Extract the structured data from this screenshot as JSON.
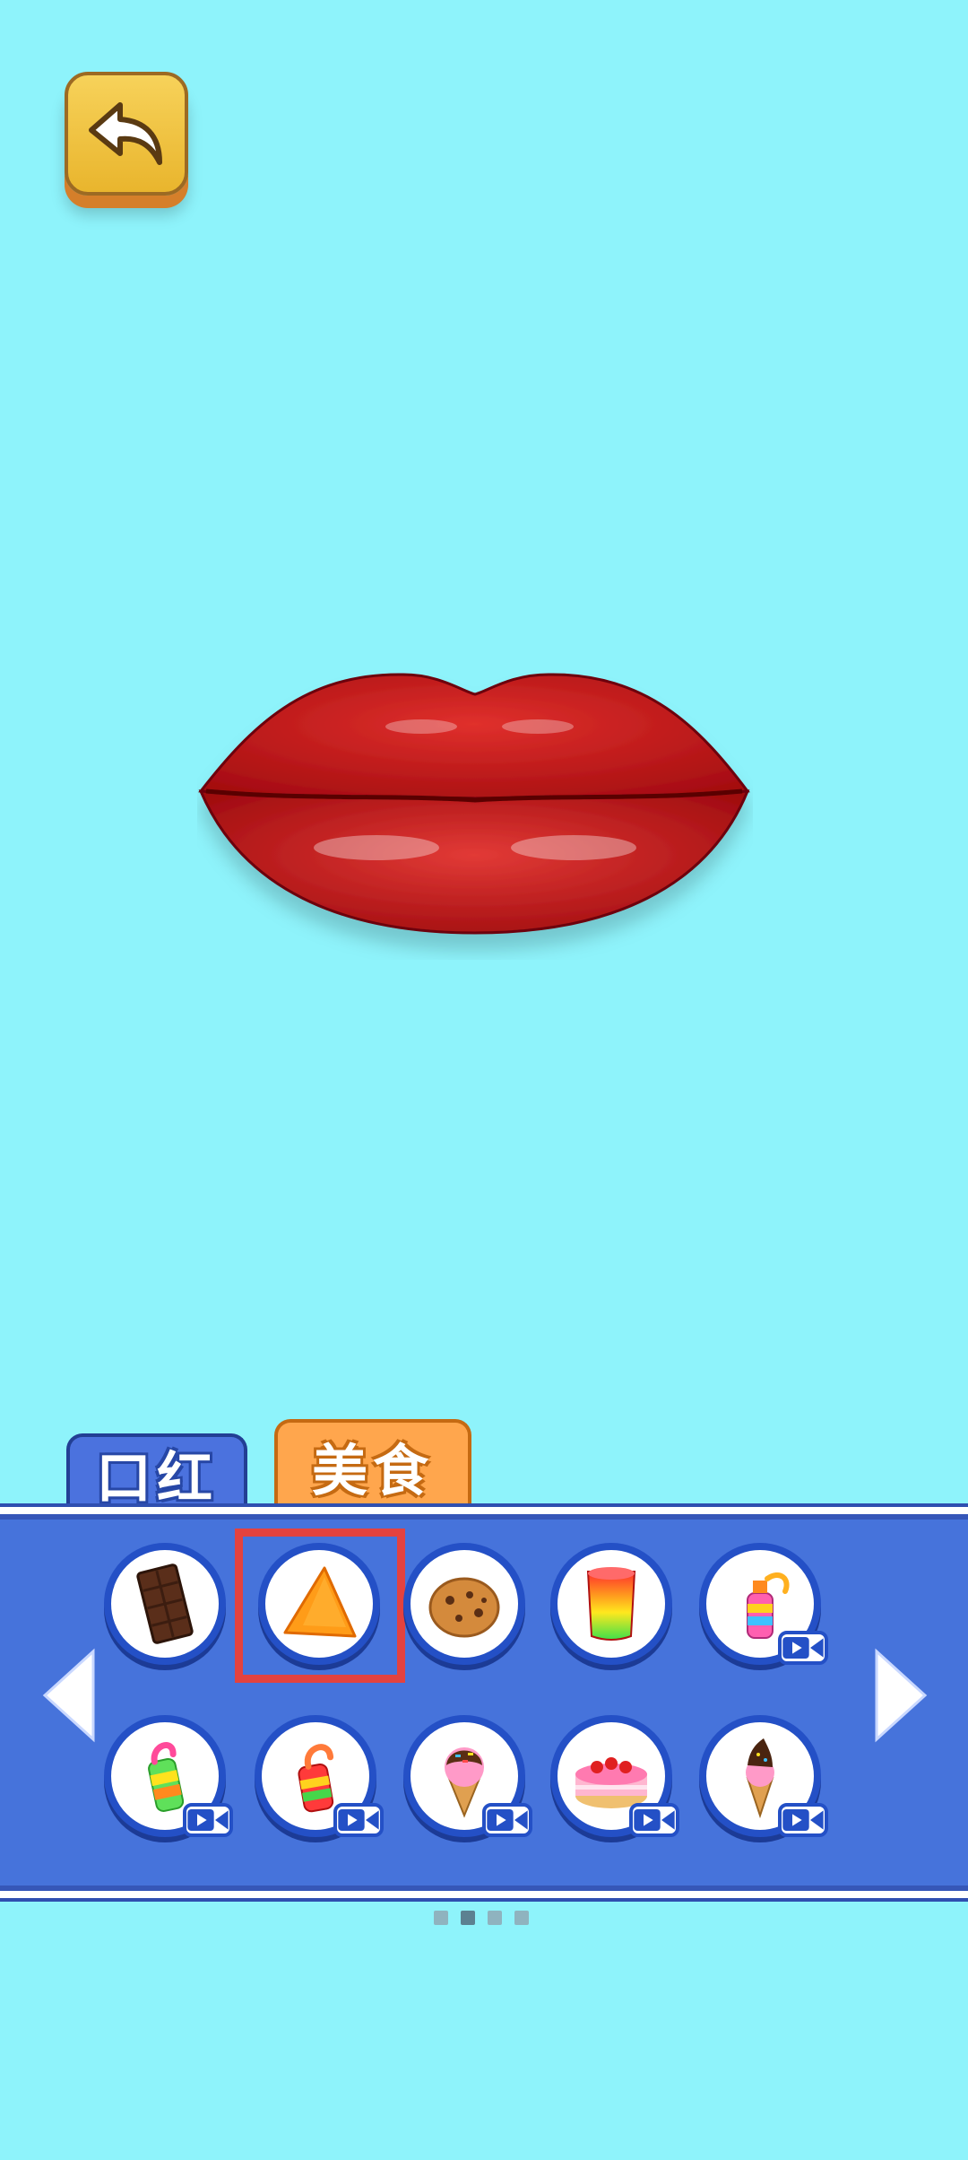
{
  "tabs": [
    {
      "label": "口红",
      "active": false
    },
    {
      "label": "美食",
      "active": true
    }
  ],
  "items": [
    {
      "icon": "chocolate-bar-icon",
      "locked_video": false,
      "selected": false
    },
    {
      "icon": "nacho-chip-icon",
      "locked_video": false,
      "selected": true
    },
    {
      "icon": "cookie-icon",
      "locked_video": false,
      "selected": false
    },
    {
      "icon": "rainbow-jelly-cup-icon",
      "locked_video": false,
      "selected": false
    },
    {
      "icon": "candy-spray-bottle-icon",
      "locked_video": true,
      "selected": false
    },
    {
      "icon": "gummy-bottle-icon",
      "locked_video": true,
      "selected": false
    },
    {
      "icon": "candy-spray-bottle-2-icon",
      "locked_video": true,
      "selected": false
    },
    {
      "icon": "sprinkle-ice-cream-icon",
      "locked_video": true,
      "selected": false
    },
    {
      "icon": "strawberry-cake-icon",
      "locked_video": true,
      "selected": false
    },
    {
      "icon": "chocolate-ice-cream-icon",
      "locked_video": true,
      "selected": false
    }
  ],
  "pagination": {
    "pages": 4,
    "current": 2
  },
  "colors": {
    "background": "#8ef3fb",
    "panel": "#4673db",
    "tab_food": "#ffa64d",
    "tab_lipstick": "#4b72de",
    "lips": "#c81818",
    "selection": "#e3423f"
  }
}
